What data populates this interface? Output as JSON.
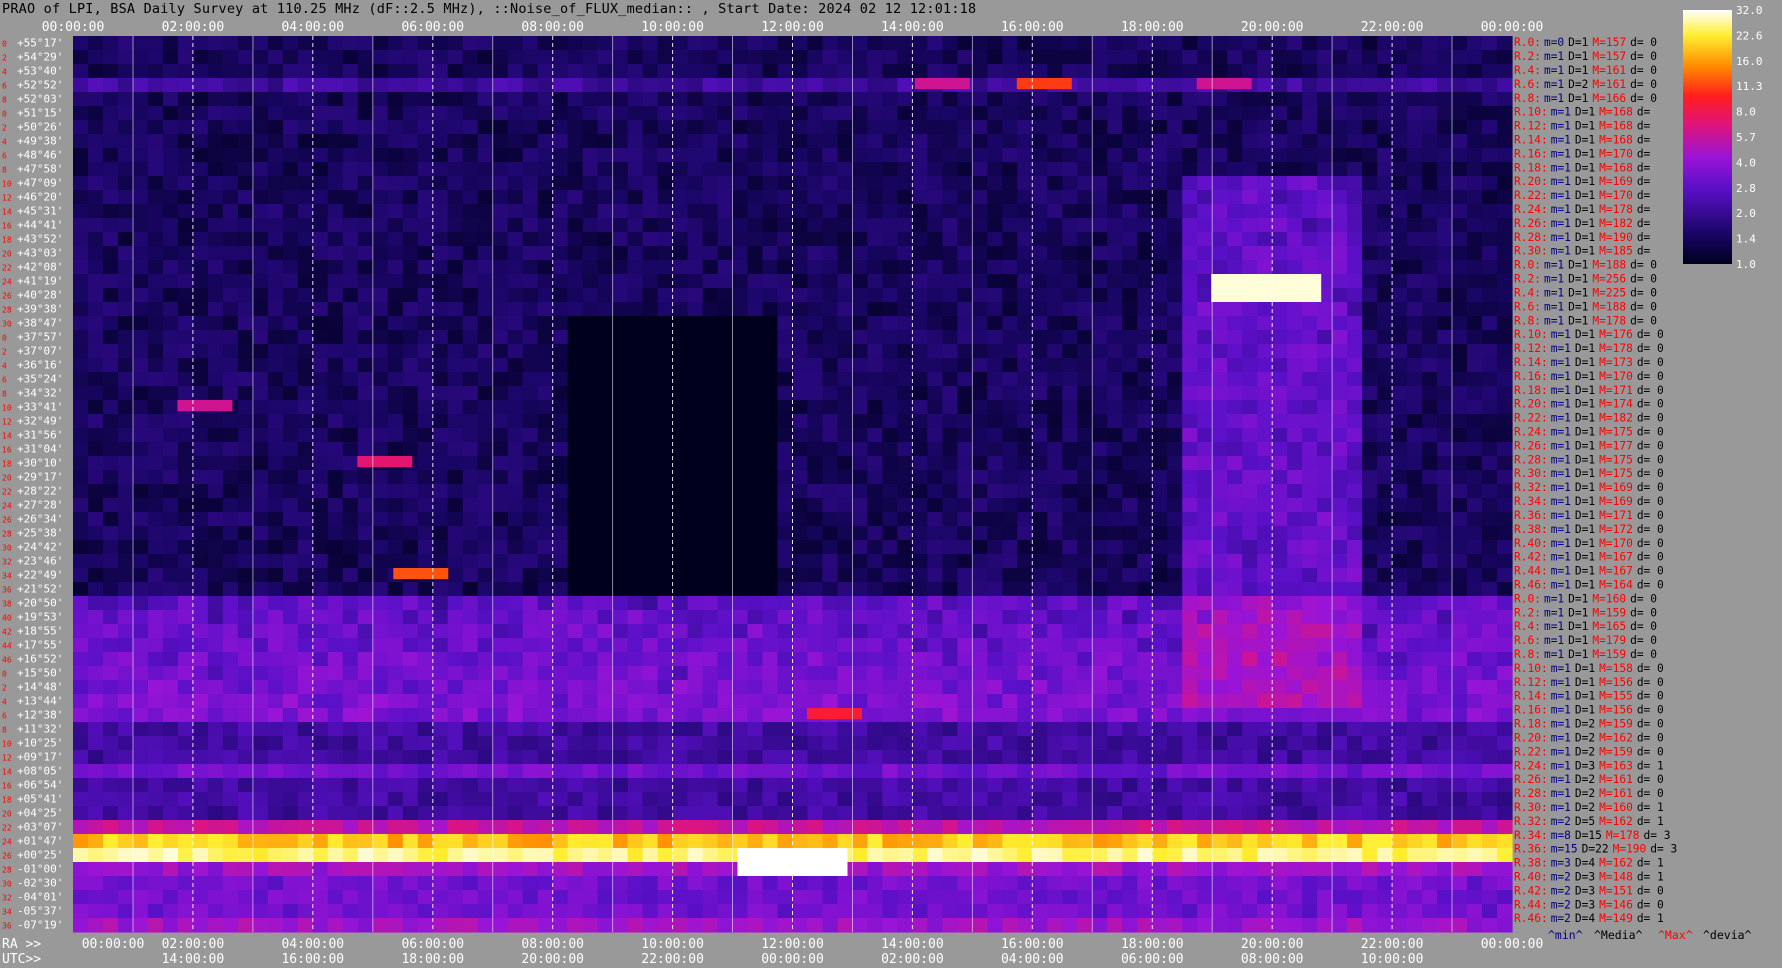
{
  "title": "PRAO of LPI, BSA Daily Survey at 110.25 MHz (dF::2.5 MHz), ::Noise_of_FLUX_median:: , Start Date: 2024 02 12 12:01:18",
  "chart_data": {
    "type": "heatmap",
    "title": "PRAO of LPI, BSA Daily Survey at 110.25 MHz (dF::2.5 MHz), ::Noise_of_FLUX_median:: , Start Date: 2024 02 12 12:01:18",
    "x_top_ticks": [
      "00:00:00",
      "02:00:00",
      "04:00:00",
      "06:00:00",
      "08:00:00",
      "10:00:00",
      "12:00:00",
      "14:00:00",
      "16:00:00",
      "18:00:00",
      "20:00:00",
      "22:00:00",
      "00:00:00"
    ],
    "x_bottom_ticks_ra": [
      "00:00:00",
      "02:00:00",
      "04:00:00",
      "06:00:00",
      "08:00:00",
      "10:00:00",
      "12:00:00",
      "14:00:00",
      "16:00:00",
      "18:00:00",
      "20:00:00",
      "22:00:00",
      "00:00:00"
    ],
    "x_bottom_ticks_utc": [
      "14:00:00",
      "16:00:00",
      "18:00:00",
      "20:00:00",
      "22:00:00",
      "00:00:00",
      "02:00:00",
      "04:00:00",
      "06:00:00",
      "08:00:00",
      "10:00:00"
    ],
    "ra_prefix": "RA >>",
    "utc_prefix": "UTC>>",
    "dec_labels": [
      "+55°17'",
      "+54°29'",
      "+53°40'",
      "+52°52'",
      "+52°03'",
      "+51°15'",
      "+50°26'",
      "+49°38'",
      "+48°46'",
      "+47°58'",
      "+47°09'",
      "+46°20'",
      "+45°31'",
      "+44°41'",
      "+43°52'",
      "+43°03'",
      "+42°08'",
      "+41°19'",
      "+40°28'",
      "+39°38'",
      "+38°47'",
      "+37°57'",
      "+37°07'",
      "+36°16'",
      "+35°24'",
      "+34°32'",
      "+33°41'",
      "+32°49'",
      "+31°56'",
      "+31°04'",
      "+30°10'",
      "+29°17'",
      "+28°22'",
      "+27°28'",
      "+26°34'",
      "+25°38'",
      "+24°42'",
      "+23°46'",
      "+22°49'",
      "+21°52'",
      "+20°50'",
      "+19°53'",
      "+18°55'",
      "+17°55'",
      "+16°52'",
      "+15°50'",
      "+14°48'",
      "+13°44'",
      "+12°38'",
      "+11°32'",
      "+10°25'",
      "+09°17'",
      "+08°05'",
      "+06°54'",
      "+05°41'",
      "+04°25'",
      "+03°07'",
      "+01°47'",
      "+00°25'",
      "-01°00'",
      "-02°30'",
      "-04°01'",
      "-05°37'",
      "-07°19'"
    ],
    "row_index_labels": [
      "0",
      "2",
      "4",
      "6",
      "8",
      "0",
      "2",
      "4",
      "6",
      "8",
      "10",
      "12",
      "14",
      "16",
      "18",
      "20",
      "22",
      "24",
      "26",
      "28",
      "30",
      "0",
      "2",
      "4",
      "6",
      "8",
      "10",
      "12",
      "14",
      "16",
      "18",
      "20",
      "22",
      "24",
      "26",
      "28",
      "30",
      "32",
      "34",
      "36",
      "38",
      "40",
      "42",
      "44",
      "46",
      "0",
      "2",
      "4",
      "6",
      "8",
      "10",
      "12",
      "14",
      "16",
      "18",
      "20",
      "22",
      "24",
      "26",
      "28",
      "30",
      "32",
      "34",
      "36",
      "38",
      "40",
      "42",
      "44",
      "46"
    ],
    "right_stats": [
      {
        "r": "R.0:",
        "m": "m=0",
        "d": "D=1",
        "M": "M=157",
        "dev": "d= 0"
      },
      {
        "r": "R.2:",
        "m": "m=1",
        "d": "D=1",
        "M": "M=157",
        "dev": "d= 0"
      },
      {
        "r": "R.4:",
        "m": "m=1",
        "d": "D=1",
        "M": "M=161",
        "dev": "d= 0"
      },
      {
        "r": "R.6:",
        "m": "m=1",
        "d": "D=2",
        "M": "M=161",
        "dev": "d= 0"
      },
      {
        "r": "R.8:",
        "m": "m=1",
        "d": "D=1",
        "M": "M=166",
        "dev": "d= 0"
      },
      {
        "r": "R.10:",
        "m": "m=1",
        "d": "D=1",
        "M": "M=168",
        "dev": "d="
      },
      {
        "r": "R.12:",
        "m": "m=1",
        "d": "D=1",
        "M": "M=168",
        "dev": "d="
      },
      {
        "r": "R.14:",
        "m": "m=1",
        "d": "D=1",
        "M": "M=168",
        "dev": "d="
      },
      {
        "r": "R.16:",
        "m": "m=1",
        "d": "D=1",
        "M": "M=170",
        "dev": "d="
      },
      {
        "r": "R.18:",
        "m": "m=1",
        "d": "D=1",
        "M": "M=168",
        "dev": "d="
      },
      {
        "r": "R.20:",
        "m": "m=1",
        "d": "D=1",
        "M": "M=169",
        "dev": "d="
      },
      {
        "r": "R.22:",
        "m": "m=1",
        "d": "D=1",
        "M": "M=170",
        "dev": "d="
      },
      {
        "r": "R.24:",
        "m": "m=1",
        "d": "D=1",
        "M": "M=178",
        "dev": "d="
      },
      {
        "r": "R.26:",
        "m": "m=1",
        "d": "D=1",
        "M": "M=182",
        "dev": "d="
      },
      {
        "r": "R.28:",
        "m": "m=1",
        "d": "D=1",
        "M": "M=190",
        "dev": "d="
      },
      {
        "r": "R.30:",
        "m": "m=1",
        "d": "D=1",
        "M": "M=185",
        "dev": "d="
      },
      {
        "r": "R.0:",
        "m": "m=1",
        "d": "D=1",
        "M": "M=188",
        "dev": "d= 0"
      },
      {
        "r": "R.2:",
        "m": "m=1",
        "d": "D=1",
        "M": "M=256",
        "dev": "d= 0"
      },
      {
        "r": "R.4:",
        "m": "m=1",
        "d": "D=1",
        "M": "M=225",
        "dev": "d= 0"
      },
      {
        "r": "R.6:",
        "m": "m=1",
        "d": "D=1",
        "M": "M=188",
        "dev": "d= 0"
      },
      {
        "r": "R.8:",
        "m": "m=1",
        "d": "D=1",
        "M": "M=178",
        "dev": "d= 0"
      },
      {
        "r": "R.10:",
        "m": "m=1",
        "d": "D=1",
        "M": "M=176",
        "dev": "d= 0"
      },
      {
        "r": "R.12:",
        "m": "m=1",
        "d": "D=1",
        "M": "M=178",
        "dev": "d= 0"
      },
      {
        "r": "R.14:",
        "m": "m=1",
        "d": "D=1",
        "M": "M=173",
        "dev": "d= 0"
      },
      {
        "r": "R.16:",
        "m": "m=1",
        "d": "D=1",
        "M": "M=170",
        "dev": "d= 0"
      },
      {
        "r": "R.18:",
        "m": "m=1",
        "d": "D=1",
        "M": "M=171",
        "dev": "d= 0"
      },
      {
        "r": "R.20:",
        "m": "m=1",
        "d": "D=1",
        "M": "M=174",
        "dev": "d= 0"
      },
      {
        "r": "R.22:",
        "m": "m=1",
        "d": "D=1",
        "M": "M=182",
        "dev": "d= 0"
      },
      {
        "r": "R.24:",
        "m": "m=1",
        "d": "D=1",
        "M": "M=175",
        "dev": "d= 0"
      },
      {
        "r": "R.26:",
        "m": "m=1",
        "d": "D=1",
        "M": "M=177",
        "dev": "d= 0"
      },
      {
        "r": "R.28:",
        "m": "m=1",
        "d": "D=1",
        "M": "M=175",
        "dev": "d= 0"
      },
      {
        "r": "R.30:",
        "m": "m=1",
        "d": "D=1",
        "M": "M=175",
        "dev": "d= 0"
      },
      {
        "r": "R.32:",
        "m": "m=1",
        "d": "D=1",
        "M": "M=169",
        "dev": "d= 0"
      },
      {
        "r": "R.34:",
        "m": "m=1",
        "d": "D=1",
        "M": "M=169",
        "dev": "d= 0"
      },
      {
        "r": "R.36:",
        "m": "m=1",
        "d": "D=1",
        "M": "M=171",
        "dev": "d= 0"
      },
      {
        "r": "R.38:",
        "m": "m=1",
        "d": "D=1",
        "M": "M=172",
        "dev": "d= 0"
      },
      {
        "r": "R.40:",
        "m": "m=1",
        "d": "D=1",
        "M": "M=170",
        "dev": "d= 0"
      },
      {
        "r": "R.42:",
        "m": "m=1",
        "d": "D=1",
        "M": "M=167",
        "dev": "d= 0"
      },
      {
        "r": "R.44:",
        "m": "m=1",
        "d": "D=1",
        "M": "M=167",
        "dev": "d= 0"
      },
      {
        "r": "R.46:",
        "m": "m=1",
        "d": "D=1",
        "M": "M=164",
        "dev": "d= 0"
      },
      {
        "r": "R.0:",
        "m": "m=1",
        "d": "D=1",
        "M": "M=160",
        "dev": "d= 0"
      },
      {
        "r": "R.2:",
        "m": "m=1",
        "d": "D=1",
        "M": "M=159",
        "dev": "d= 0"
      },
      {
        "r": "R.4:",
        "m": "m=1",
        "d": "D=1",
        "M": "M=165",
        "dev": "d= 0"
      },
      {
        "r": "R.6:",
        "m": "m=1",
        "d": "D=1",
        "M": "M=179",
        "dev": "d= 0"
      },
      {
        "r": "R.8:",
        "m": "m=1",
        "d": "D=1",
        "M": "M=159",
        "dev": "d= 0"
      },
      {
        "r": "R.10:",
        "m": "m=1",
        "d": "D=1",
        "M": "M=158",
        "dev": "d= 0"
      },
      {
        "r": "R.12:",
        "m": "m=1",
        "d": "D=1",
        "M": "M=156",
        "dev": "d= 0"
      },
      {
        "r": "R.14:",
        "m": "m=1",
        "d": "D=1",
        "M": "M=155",
        "dev": "d= 0"
      },
      {
        "r": "R.16:",
        "m": "m=1",
        "d": "D=1",
        "M": "M=156",
        "dev": "d= 0"
      },
      {
        "r": "R.18:",
        "m": "m=1",
        "d": "D=2",
        "M": "M=159",
        "dev": "d= 0"
      },
      {
        "r": "R.20:",
        "m": "m=1",
        "d": "D=2",
        "M": "M=162",
        "dev": "d= 0"
      },
      {
        "r": "R.22:",
        "m": "m=1",
        "d": "D=2",
        "M": "M=159",
        "dev": "d= 0"
      },
      {
        "r": "R.24:",
        "m": "m=1",
        "d": "D=3",
        "M": "M=163",
        "dev": "d= 1"
      },
      {
        "r": "R.26:",
        "m": "m=1",
        "d": "D=2",
        "M": "M=161",
        "dev": "d= 0"
      },
      {
        "r": "R.28:",
        "m": "m=1",
        "d": "D=2",
        "M": "M=161",
        "dev": "d= 0"
      },
      {
        "r": "R.30:",
        "m": "m=1",
        "d": "D=2",
        "M": "M=160",
        "dev": "d= 1"
      },
      {
        "r": "R.32:",
        "m": "m=2",
        "d": "D=5",
        "M": "M=162",
        "dev": "d= 1"
      },
      {
        "r": "R.34:",
        "m": "m=8",
        "d": "D=15",
        "M": "M=178",
        "dev": "d= 3"
      },
      {
        "r": "R.36:",
        "m": "m=15",
        "d": "D=22",
        "M": "M=190",
        "dev": "d= 3"
      },
      {
        "r": "R.38:",
        "m": "m=3",
        "d": "D=4",
        "M": "M=162",
        "dev": "d= 1"
      },
      {
        "r": "R.40:",
        "m": "m=2",
        "d": "D=3",
        "M": "M=148",
        "dev": "d= 1"
      },
      {
        "r": "R.42:",
        "m": "m=2",
        "d": "D=3",
        "M": "M=151",
        "dev": "d= 0"
      },
      {
        "r": "R.44:",
        "m": "m=2",
        "d": "D=3",
        "M": "M=146",
        "dev": "d= 0"
      },
      {
        "r": "R.46:",
        "m": "m=2",
        "d": "D=4",
        "M": "M=149",
        "dev": "d= 1"
      }
    ],
    "colorbar_ticks": [
      "32.0",
      "22.6",
      "16.0",
      "11.3",
      "8.0",
      "5.7",
      "4.0",
      "2.8",
      "2.0",
      "1.4",
      "1.0"
    ],
    "colorbar_scale": "log",
    "colorbar_range": [
      1.0,
      32.0
    ],
    "stat_legend": {
      "min": "^min^",
      "media": "^Media^",
      "max": "^Max^",
      "devia": "^devia^"
    },
    "hot_features": [
      {
        "x_hour": 2.2,
        "dec": "+33°41'",
        "level": 6
      },
      {
        "x_hour": 5.2,
        "dec": "+30°10'",
        "level": 7
      },
      {
        "x_hour": 5.8,
        "dec": "+22°49'",
        "level": 12
      },
      {
        "x_hour": 14.5,
        "dec": "+52°52'",
        "level": 6
      },
      {
        "x_hour": 16.2,
        "dec": "+52°52'",
        "level": 11
      },
      {
        "x_hour": 19.2,
        "dec": "+52°52'",
        "level": 6
      },
      {
        "x_hour": 19.9,
        "dec": "+41°19'",
        "level": 30
      },
      {
        "x_hour": 12.7,
        "dec": "+12°38'",
        "level": 9
      },
      {
        "x_hour": 12.0,
        "dec": "+00°25'",
        "level": 32
      }
    ],
    "colors": {
      "low": "#00001e",
      "mid": "#7a14d8",
      "high": "#ff2a00",
      "max": "#ffffff",
      "axis": "#ffffff",
      "stat_label": "#ff0000",
      "stat_value": "#000080"
    }
  }
}
